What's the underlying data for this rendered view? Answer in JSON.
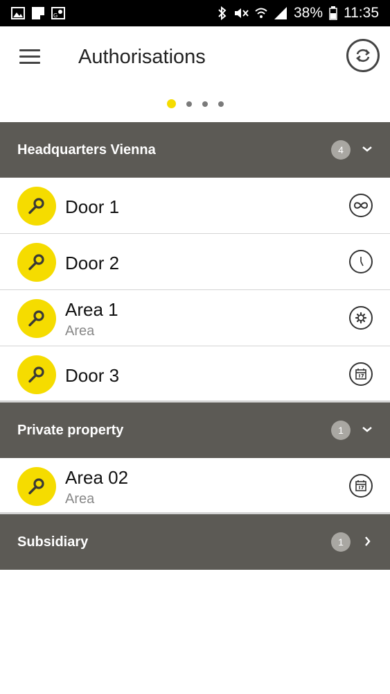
{
  "status_bar": {
    "battery": "38%",
    "time": "11:35"
  },
  "app_bar": {
    "title": "Authorisations",
    "menu_icon": "hamburger-menu-icon",
    "sync_icon": "sync-icon"
  },
  "pager": {
    "pages": 4,
    "active_index": 0
  },
  "colors": {
    "accent": "#f5dc00",
    "header_bg": "#5c5a55",
    "badge_bg": "#a9a7a2"
  },
  "groups": [
    {
      "title": "Headquarters Vienna",
      "count": "4",
      "expanded": true,
      "items": [
        {
          "name": "Door 1",
          "subtitle": "",
          "type_icon": "infinity-icon"
        },
        {
          "name": "Door 2",
          "subtitle": "",
          "type_icon": "clock-icon"
        },
        {
          "name": "Area 1",
          "subtitle": "Area",
          "type_icon": "gear-icon"
        },
        {
          "name": "Door 3",
          "subtitle": "",
          "type_icon": "calendar-icon"
        }
      ]
    },
    {
      "title": "Private property",
      "count": "1",
      "expanded": true,
      "items": [
        {
          "name": "Area 02",
          "subtitle": "Area",
          "type_icon": "calendar-icon"
        }
      ]
    },
    {
      "title": "Subsidiary",
      "count": "1",
      "expanded": false,
      "items": []
    }
  ]
}
